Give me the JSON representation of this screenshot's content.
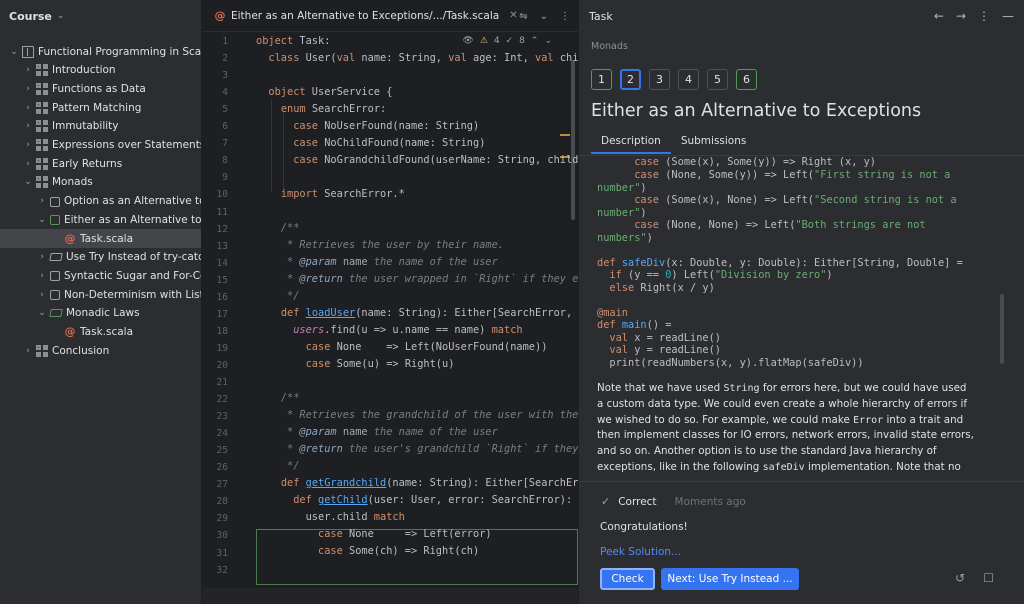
{
  "course_panel": {
    "title": "Course",
    "tree": [
      {
        "label": "Functional Programming in Scala",
        "indent": 0,
        "arrow": "⌄",
        "icon": "book"
      },
      {
        "label": "Introduction",
        "indent": 1,
        "arrow": "›",
        "icon": "grid"
      },
      {
        "label": "Functions as Data",
        "indent": 1,
        "arrow": "›",
        "icon": "grid"
      },
      {
        "label": "Pattern Matching",
        "indent": 1,
        "arrow": "›",
        "icon": "grid"
      },
      {
        "label": "Immutability",
        "indent": 1,
        "arrow": "›",
        "icon": "grid"
      },
      {
        "label": "Expressions over Statements",
        "indent": 1,
        "arrow": "›",
        "icon": "grid"
      },
      {
        "label": "Early Returns",
        "indent": 1,
        "arrow": "›",
        "icon": "grid"
      },
      {
        "label": "Monads",
        "indent": 1,
        "arrow": "⌄",
        "icon": "grid"
      },
      {
        "label": "Option as an Alternative to n",
        "indent": 2,
        "arrow": "›",
        "icon": "square"
      },
      {
        "label": "Either as an Alternative to E",
        "indent": 2,
        "arrow": "⌄",
        "icon": "square-green"
      },
      {
        "label": "Task.scala",
        "indent": 3,
        "arrow": "",
        "icon": "scala",
        "selected": true
      },
      {
        "label": "Use Try Instead of try-catch",
        "indent": 2,
        "arrow": "›",
        "icon": "hat"
      },
      {
        "label": "Syntactic Sugar and For-Co",
        "indent": 2,
        "arrow": "›",
        "icon": "square"
      },
      {
        "label": "Non-Determinism with Lists",
        "indent": 2,
        "arrow": "›",
        "icon": "square"
      },
      {
        "label": "Monadic Laws",
        "indent": 2,
        "arrow": "⌄",
        "icon": "hat-green"
      },
      {
        "label": "Task.scala",
        "indent": 3,
        "arrow": "",
        "icon": "scala"
      },
      {
        "label": "Conclusion",
        "indent": 1,
        "arrow": "›",
        "icon": "grid"
      }
    ]
  },
  "editor": {
    "tab_title": "Either as an Alternative to Exceptions/.../Task.scala",
    "inspection_warnings": "4",
    "inspection_weak": "8",
    "line_numbers": [
      "1",
      "2",
      "3",
      "4",
      "5",
      "6",
      "7",
      "8",
      "9",
      "10",
      "11",
      "12",
      "13",
      "14",
      "15",
      "16",
      "17",
      "18",
      "19",
      "20",
      "21",
      "22",
      "23",
      "24",
      "25",
      "26",
      "27",
      "28",
      "29",
      "30",
      "31",
      "32"
    ]
  },
  "task_panel": {
    "title": "Task",
    "breadcrumb": "Monads",
    "steps": [
      "1",
      "2",
      "3",
      "4",
      "5",
      "6"
    ],
    "task_title": "Either as an Alternative to Exceptions",
    "tabs": [
      "Description",
      "Submissions"
    ],
    "description_paragraph": [
      {
        "t": "Note that we have used "
      },
      {
        "c": "String"
      },
      {
        "t": " for errors here, but we could have used a custom data type. We could even create a whole hierarchy of errors if we wished to do so. For example, we could make "
      },
      {
        "c": "Error"
      },
      {
        "t": " into a trait and then implement classes for IO errors, network errors, invalid state errors, and so on. Another option is to use the standard Java hierarchy of exceptions, like in the following "
      },
      {
        "c": "safeDiv"
      },
      {
        "t": " implementation. Note that no exception is actually thrown here:"
      }
    ],
    "status": "Correct",
    "status_time": "Moments ago",
    "congrats": "Congratulations!",
    "peek_link": "Peek Solution...",
    "check_button": "Check",
    "next_button": "Next: Use Try Instead ..."
  }
}
